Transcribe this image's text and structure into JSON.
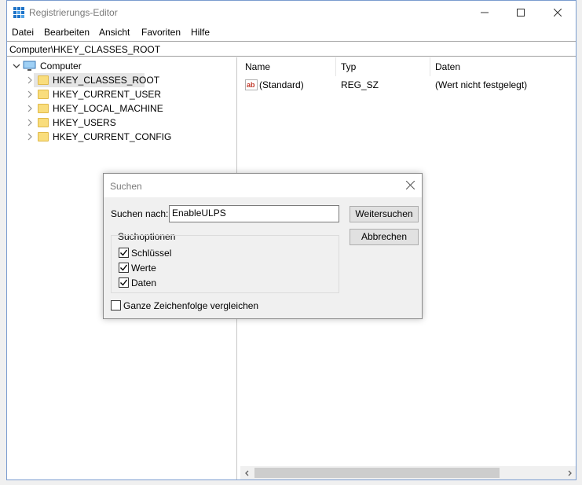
{
  "window": {
    "title": "Registrierungs-Editor",
    "minimize": "—",
    "maximize": "☐",
    "close": "✕"
  },
  "menu": [
    "Datei",
    "Bearbeiten",
    "Ansicht",
    "Favoriten",
    "Hilfe"
  ],
  "address": "Computer\\HKEY_CLASSES_ROOT",
  "tree": {
    "root": "Computer",
    "items": [
      "HKEY_CLASSES_ROOT",
      "HKEY_CURRENT_USER",
      "HKEY_LOCAL_MACHINE",
      "HKEY_USERS",
      "HKEY_CURRENT_CONFIG"
    ],
    "selected_index": 0
  },
  "list": {
    "columns": [
      "Name",
      "Typ",
      "Daten"
    ],
    "rows": [
      {
        "name": "(Standard)",
        "type": "REG_SZ",
        "data": "(Wert nicht festgelegt)",
        "icon": "string-value-icon"
      }
    ]
  },
  "dialog": {
    "title": "Suchen",
    "search_label": "Suchen nach:",
    "search_value": "EnableULPS",
    "find_next": "Weitersuchen",
    "cancel": "Abbrechen",
    "options_label": "Suchoptionen",
    "options": [
      {
        "label": "Schlüssel",
        "checked": true
      },
      {
        "label": "Werte",
        "checked": true
      },
      {
        "label": "Daten",
        "checked": true
      }
    ],
    "match_whole": {
      "label": "Ganze Zeichenfolge vergleichen",
      "checked": false
    }
  },
  "colors": {
    "folder": "#f9dd7c",
    "selection": "#e5e5e5",
    "value_icon": "#c0392b"
  }
}
